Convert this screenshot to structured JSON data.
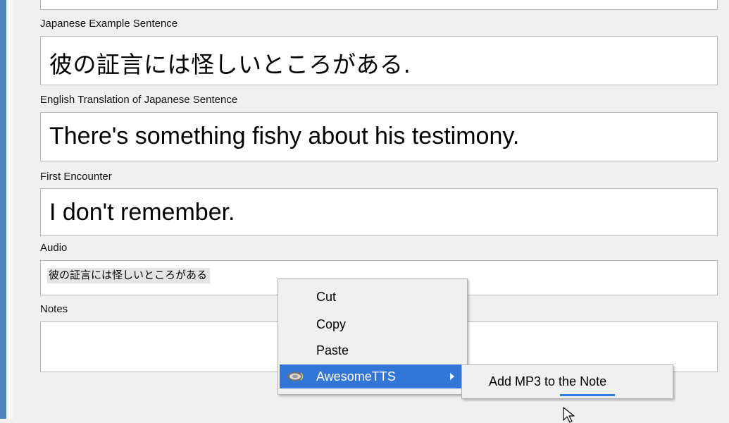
{
  "fields": [
    {
      "label": "Japanese Example Sentence",
      "value": "彼の証言には怪しいところがある."
    },
    {
      "label": "English Translation of Japanese Sentence",
      "value": "There's something fishy about his testimony."
    },
    {
      "label": "First Encounter",
      "value": "I don't remember."
    },
    {
      "label": "Audio",
      "value": "彼の証言には怪しいところがある"
    },
    {
      "label": "Notes",
      "value": ""
    }
  ],
  "context_menu": {
    "items": [
      {
        "label": "Cut"
      },
      {
        "label": "Copy"
      },
      {
        "label": "Paste"
      },
      {
        "label": "AwesomeTTS",
        "icon": "speaker-icon",
        "has_submenu": true
      }
    ],
    "submenu": {
      "items": [
        {
          "label": "Add MP3 to the Note"
        }
      ]
    }
  },
  "colors": {
    "accent_strip": "#4f83bf",
    "menu_highlight": "#3476d6"
  }
}
